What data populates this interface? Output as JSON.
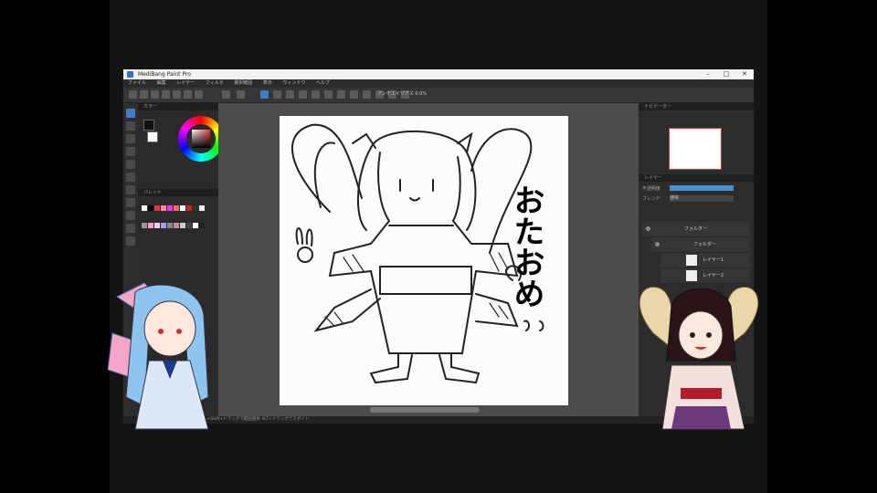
{
  "window": {
    "title": "MediBang Paint Pro",
    "menu": [
      "ファイル",
      "編集",
      "レイヤー",
      "フィルタ",
      "選択範囲",
      "表示",
      "ウィンドウ",
      "ヘルプ"
    ],
    "toolbar_text": "アンチエイリアス 0.0%"
  },
  "panels": {
    "color": "カラー",
    "palette": "パレット",
    "navigator": "ナビゲーター",
    "layer": "レイヤー",
    "opacity": "不透明度",
    "blend": "ブレンド",
    "blend_value": "通常"
  },
  "layers": [
    {
      "name": "フォルダー"
    },
    {
      "name": "フォルダー"
    },
    {
      "name": "レイヤー1"
    },
    {
      "name": "レイヤー2"
    }
  ],
  "canvas": {
    "vertical_text": "おたおめ"
  },
  "status_text": "CTRL+Shift+ドラッグで範囲選択 ALT+ドラッグでスポイト",
  "colors": {
    "accent": "#3d7fc7",
    "toolbar": "#353535",
    "canvas_bg": "#4c4c4c"
  }
}
